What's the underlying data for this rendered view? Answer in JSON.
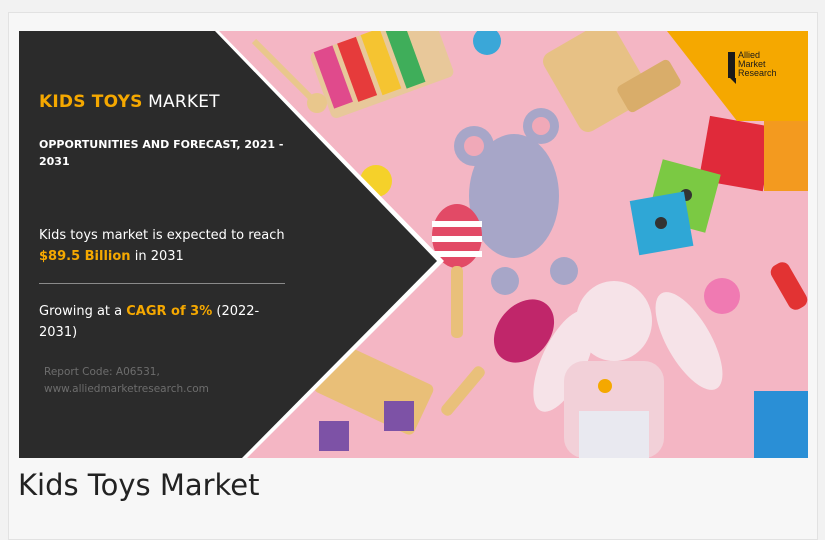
{
  "banner": {
    "title_highlight": "KIDS TOYS",
    "title_rest": " MARKET",
    "subtitle": "OPPORTUNITIES AND FORECAST, 2021 - 2031",
    "stat1_prefix": "Kids toys market is expected to reach ",
    "stat1_value": "$89.5 Billion",
    "stat1_suffix": " in 2031",
    "stat2_prefix": "Growing at a ",
    "stat2_value": "CAGR of 3%",
    "stat2_suffix": " (2022-2031)",
    "report_code": "Report Code: A06531,",
    "website": "www.alliedmarketresearch.com",
    "logo_line1": "Allied",
    "logo_line2": "Market",
    "logo_line3": "Research"
  },
  "caption": "Kids Toys Market",
  "colors": {
    "accent": "#f5a800",
    "panel": "#2b2b2b",
    "background_pink": "#f5b8c6"
  }
}
